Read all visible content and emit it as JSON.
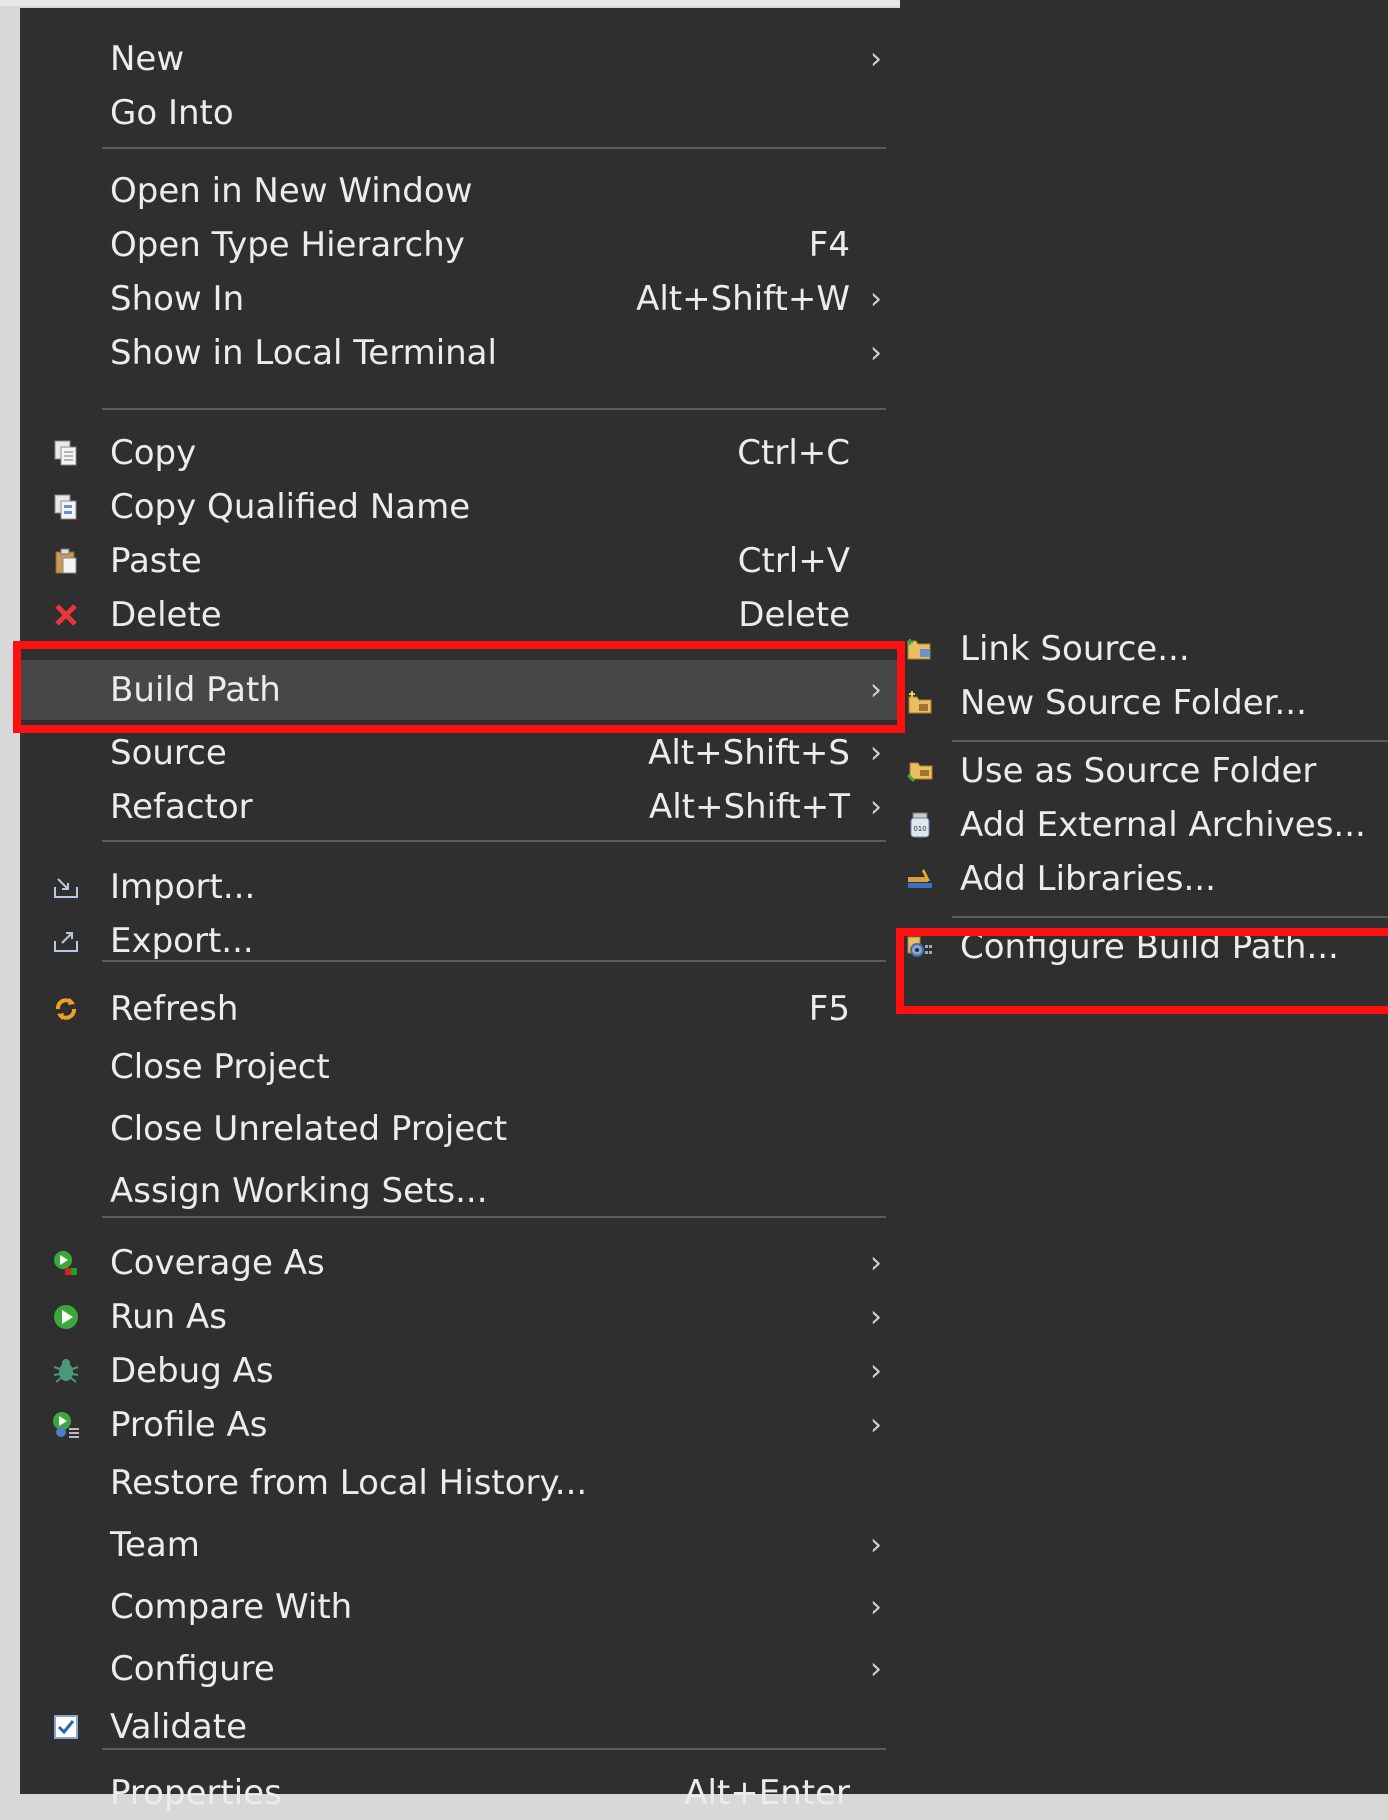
{
  "main_menu": {
    "new": {
      "label": "New",
      "submenu": true
    },
    "go_into": {
      "label": "Go Into"
    },
    "open_in_new_window": {
      "label": "Open in New Window"
    },
    "open_type_hierarchy": {
      "label": "Open Type Hierarchy",
      "shortcut": "F4"
    },
    "show_in": {
      "label": "Show In",
      "shortcut": "Alt+Shift+W",
      "submenu": true
    },
    "show_in_local_terminal": {
      "label": "Show in Local Terminal",
      "submenu": true
    },
    "copy": {
      "label": "Copy",
      "shortcut": "Ctrl+C",
      "icon": "copy-icon"
    },
    "copy_qualified_name": {
      "label": "Copy Qualified Name",
      "icon": "copy-qualified-name-icon"
    },
    "paste": {
      "label": "Paste",
      "shortcut": "Ctrl+V",
      "icon": "paste-icon"
    },
    "delete": {
      "label": "Delete",
      "shortcut": "Delete",
      "icon": "delete-icon"
    },
    "build_path": {
      "label": "Build Path",
      "submenu": true,
      "selected": true
    },
    "source": {
      "label": "Source",
      "shortcut": "Alt+Shift+S",
      "submenu": true
    },
    "refactor": {
      "label": "Refactor",
      "shortcut": "Alt+Shift+T",
      "submenu": true
    },
    "import": {
      "label": "Import...",
      "icon": "import-icon"
    },
    "export": {
      "label": "Export...",
      "icon": "export-icon"
    },
    "refresh": {
      "label": "Refresh",
      "shortcut": "F5",
      "icon": "refresh-icon"
    },
    "close_project": {
      "label": "Close Project"
    },
    "close_unrelated_project": {
      "label": "Close Unrelated Project"
    },
    "assign_working_sets": {
      "label": "Assign Working Sets..."
    },
    "coverage_as": {
      "label": "Coverage As",
      "submenu": true,
      "icon": "coverage-icon"
    },
    "run_as": {
      "label": "Run As",
      "submenu": true,
      "icon": "run-icon"
    },
    "debug_as": {
      "label": "Debug As",
      "submenu": true,
      "icon": "debug-icon"
    },
    "profile_as": {
      "label": "Profile As",
      "submenu": true,
      "icon": "profile-icon"
    },
    "restore_from_local_history": {
      "label": "Restore from Local History..."
    },
    "team": {
      "label": "Team",
      "submenu": true
    },
    "compare_with": {
      "label": "Compare With",
      "submenu": true
    },
    "configure": {
      "label": "Configure",
      "submenu": true
    },
    "validate": {
      "label": "Validate",
      "icon": "validate-checkbox-icon"
    },
    "properties": {
      "label": "Properties",
      "shortcut": "Alt+Enter"
    }
  },
  "build_path_submenu": {
    "link_source": {
      "label": "Link Source...",
      "icon": "link-source-icon"
    },
    "new_source_folder": {
      "label": "New Source Folder...",
      "icon": "new-source-folder-icon"
    },
    "use_as_source_folder": {
      "label": "Use as Source Folder",
      "icon": "use-as-source-folder-icon"
    },
    "add_external_archives": {
      "label": "Add External Archives...",
      "icon": "jar-archive-icon"
    },
    "add_libraries": {
      "label": "Add Libraries...",
      "icon": "libraries-icon"
    },
    "configure_build_path": {
      "label": "Configure Build Path...",
      "icon": "configure-build-path-icon"
    }
  },
  "submenu_arrow": "›",
  "colors": {
    "menu_bg": "#2f2f2f",
    "selected_bg": "#474747",
    "highlight": "#ff1010",
    "text": "#ececec"
  }
}
